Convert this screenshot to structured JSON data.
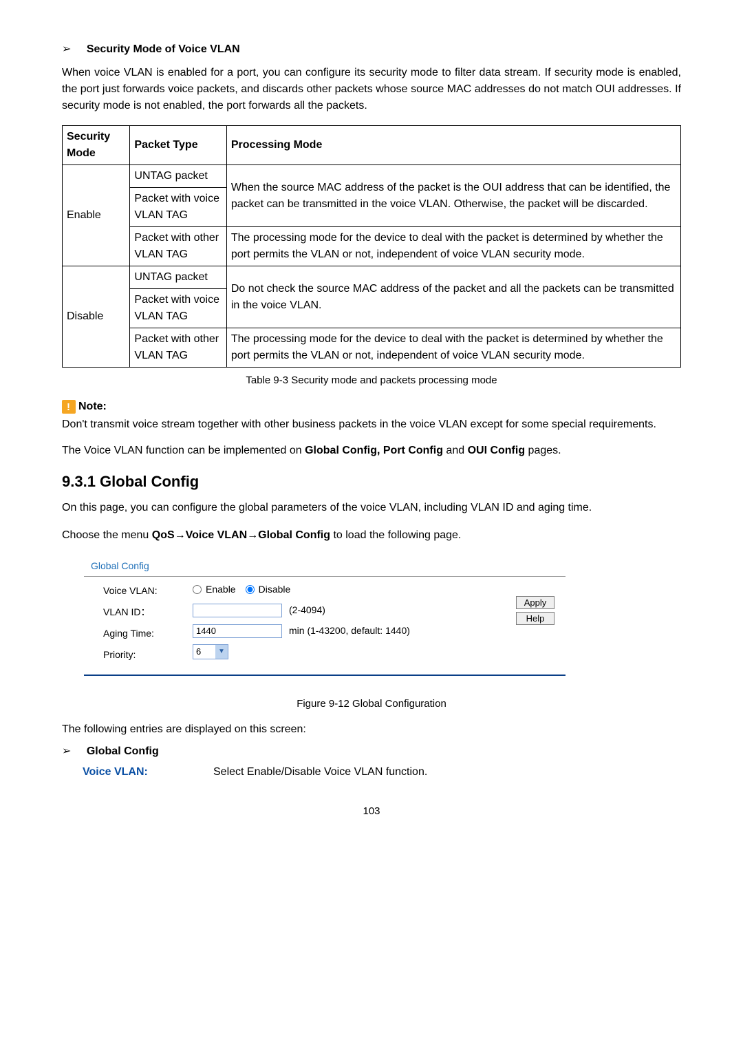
{
  "lead1": "Security Mode of Voice VLAN",
  "para1": "When voice VLAN is enabled for a port, you can configure its security mode to filter data stream. If security mode is enabled, the port just forwards voice packets, and discards other packets whose source MAC addresses do not match OUI addresses. If security mode is not enabled, the port forwards all the packets.",
  "tbl": {
    "h1": "Security Mode",
    "h2": "Packet Type",
    "h3": "Processing Mode",
    "r1c1": "Enable",
    "r1a": "UNTAG packet",
    "r1b": "Packet with voice VLAN TAG",
    "r1pm1": "When the source MAC address of the packet is the OUI address that can be identified, the packet can be transmitted in the voice VLAN. Otherwise, the packet will be discarded.",
    "r1c": "Packet with other VLAN TAG",
    "r1pm2": "The processing mode for the device to deal with the packet is determined by whether the port permits the VLAN or not, independent of voice VLAN security mode.",
    "r2c1": "Disable",
    "r2a": "UNTAG packet",
    "r2b": "Packet with voice VLAN TAG",
    "r2pm1": "Do not check the source MAC address of the packet and all the packets can be transmitted in the voice VLAN.",
    "r2c": "Packet with other VLAN TAG",
    "r2pm2": "The processing mode for the device to deal with the packet is determined by whether the port permits    the VLAN or not, independent of voice VLAN security mode."
  },
  "caption1": "Table 9-3 Security mode and packets processing mode",
  "noteLabel": "Note:",
  "noteText": "Don't transmit voice stream together with other business packets in the voice VLAN except for some special requirements.",
  "para2_pre": "The Voice VLAN function can be implemented on ",
  "para2_bold": "Global Config, Port Config",
  "para2_mid": " and ",
  "para2_bold2": "OUI Config",
  "para2_post": " pages.",
  "h2": "9.3.1 Global Config",
  "para3": "On this page, you can configure the global parameters of the voice VLAN, including VLAN ID and aging time.",
  "menu_pre": "Choose the menu ",
  "menu_bold": "QoS→Voice VLAN→Global Config",
  "menu_post": " to load the following page.",
  "cfg": {
    "title": "Global Config",
    "l1": "Voice VLAN:",
    "l2": "VLAN ID：",
    "l3": "Aging Time:",
    "l4": "Priority:",
    "enable": "Enable",
    "disable": "Disable",
    "vlanHint": "(2-4094)",
    "agingVal": "1440",
    "agingHint": "min (1-43200, default: 1440)",
    "priVal": "6",
    "apply": "Apply",
    "help": "Help"
  },
  "caption2": "Figure 9-12 Global Configuration",
  "entries": "The following entries are displayed on this screen:",
  "lead2": "Global Config",
  "field1": "Voice VLAN:",
  "field1d": "Select Enable/Disable Voice VLAN function.",
  "pg": "103"
}
